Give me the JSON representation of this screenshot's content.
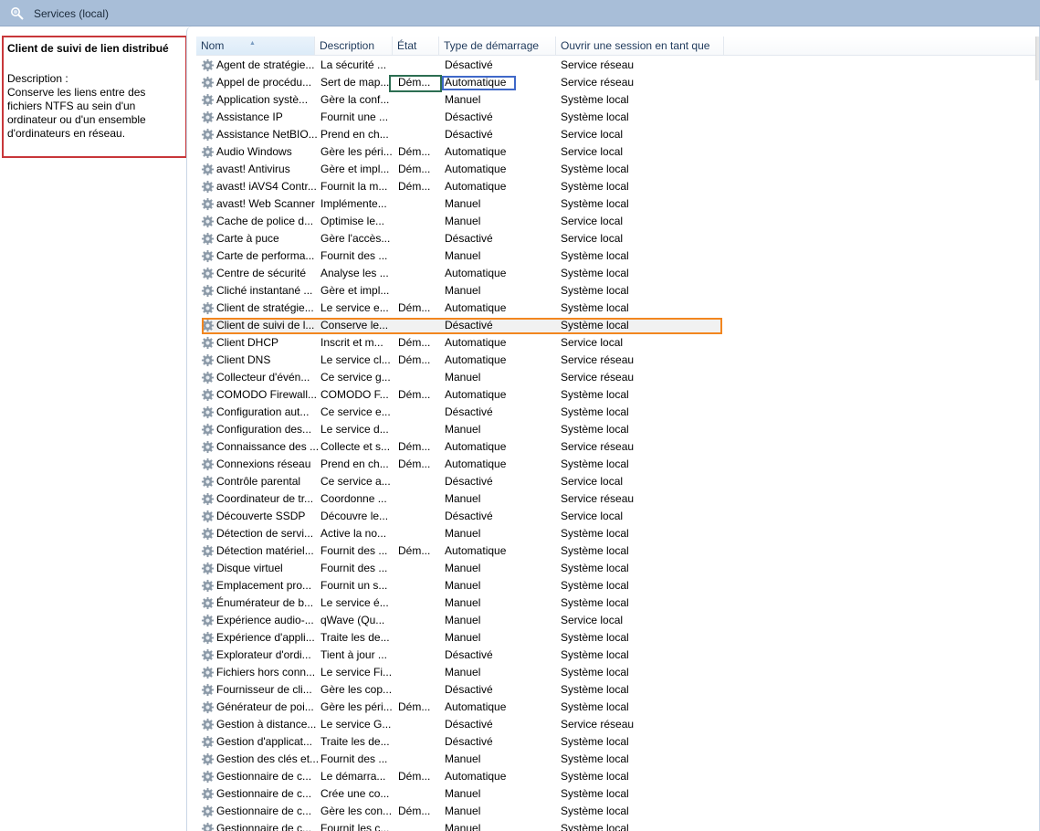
{
  "window": {
    "title": "Services (local)",
    "icon": "services-gear-search-icon"
  },
  "detail": {
    "service_name": "Client de suivi de lien distribué",
    "description_label": "Description :",
    "description_text": "Conserve les liens entre des fichiers NTFS au sein d'un ordinateur ou d'un ensemble d'ordinateurs en réseau."
  },
  "columns": [
    {
      "key": "name",
      "label": "Nom"
    },
    {
      "key": "description",
      "label": "Description"
    },
    {
      "key": "state",
      "label": "État"
    },
    {
      "key": "startup",
      "label": "Type de démarrage"
    },
    {
      "key": "logon",
      "label": "Ouvrir une session en tant que"
    }
  ],
  "sorted_column": "name",
  "selected_row_index": 15,
  "highlight_colors": {
    "details_box": "#c8373a",
    "selected_row": "#f2861f",
    "state_cell": "#2c6e52",
    "startup_cell": "#3f68c8"
  },
  "rows": [
    {
      "name": "Agent de stratégie...",
      "description": "La sécurité ...",
      "state": "",
      "startup": "Désactivé",
      "logon": "Service réseau"
    },
    {
      "name": "Appel de procédu...",
      "description": "Sert de map...",
      "state": "Dém...",
      "startup": "Automatique",
      "logon": "Service réseau"
    },
    {
      "name": "Application systè...",
      "description": "Gère la conf...",
      "state": "",
      "startup": "Manuel",
      "logon": "Système local"
    },
    {
      "name": "Assistance IP",
      "description": "Fournit une ...",
      "state": "",
      "startup": "Désactivé",
      "logon": "Système local"
    },
    {
      "name": "Assistance NetBIO...",
      "description": "Prend en ch...",
      "state": "",
      "startup": "Désactivé",
      "logon": "Service local"
    },
    {
      "name": "Audio Windows",
      "description": "Gère les péri...",
      "state": "Dém...",
      "startup": "Automatique",
      "logon": "Service local"
    },
    {
      "name": "avast! Antivirus",
      "description": "Gère et impl...",
      "state": "Dém...",
      "startup": "Automatique",
      "logon": "Système local"
    },
    {
      "name": "avast! iAVS4 Contr...",
      "description": "Fournit la m...",
      "state": "Dém...",
      "startup": "Automatique",
      "logon": "Système local"
    },
    {
      "name": "avast! Web Scanner",
      "description": "Implémente...",
      "state": "",
      "startup": "Manuel",
      "logon": "Système local"
    },
    {
      "name": "Cache de police d...",
      "description": "Optimise le...",
      "state": "",
      "startup": "Manuel",
      "logon": "Service local"
    },
    {
      "name": "Carte à puce",
      "description": "Gère l'accès...",
      "state": "",
      "startup": "Désactivé",
      "logon": "Service local"
    },
    {
      "name": "Carte de performa...",
      "description": "Fournit des ...",
      "state": "",
      "startup": "Manuel",
      "logon": "Système local"
    },
    {
      "name": "Centre de sécurité",
      "description": "Analyse les ...",
      "state": "",
      "startup": "Automatique",
      "logon": "Système local"
    },
    {
      "name": "Cliché instantané ...",
      "description": "Gère et impl...",
      "state": "",
      "startup": "Manuel",
      "logon": "Système local"
    },
    {
      "name": "Client de stratégie...",
      "description": "Le service e...",
      "state": "Dém...",
      "startup": "Automatique",
      "logon": "Système local"
    },
    {
      "name": "Client de suivi de l...",
      "description": "Conserve le...",
      "state": "",
      "startup": "Désactivé",
      "logon": "Système local"
    },
    {
      "name": "Client DHCP",
      "description": "Inscrit et m...",
      "state": "Dém...",
      "startup": "Automatique",
      "logon": "Service local"
    },
    {
      "name": "Client DNS",
      "description": "Le service cl...",
      "state": "Dém...",
      "startup": "Automatique",
      "logon": "Service réseau"
    },
    {
      "name": "Collecteur d'évén...",
      "description": "Ce service g...",
      "state": "",
      "startup": "Manuel",
      "logon": "Service réseau"
    },
    {
      "name": "COMODO Firewall...",
      "description": "COMODO F...",
      "state": "Dém...",
      "startup": "Automatique",
      "logon": "Système local"
    },
    {
      "name": "Configuration aut...",
      "description": "Ce service e...",
      "state": "",
      "startup": "Désactivé",
      "logon": "Système local"
    },
    {
      "name": "Configuration des...",
      "description": "Le service d...",
      "state": "",
      "startup": "Manuel",
      "logon": "Système local"
    },
    {
      "name": "Connaissance des ...",
      "description": "Collecte et s...",
      "state": "Dém...",
      "startup": "Automatique",
      "logon": "Service réseau"
    },
    {
      "name": "Connexions réseau",
      "description": "Prend en ch...",
      "state": "Dém...",
      "startup": "Automatique",
      "logon": "Système local"
    },
    {
      "name": "Contrôle parental",
      "description": "Ce service a...",
      "state": "",
      "startup": "Désactivé",
      "logon": "Service local"
    },
    {
      "name": "Coordinateur de tr...",
      "description": "Coordonne ...",
      "state": "",
      "startup": "Manuel",
      "logon": "Service réseau"
    },
    {
      "name": "Découverte SSDP",
      "description": "Découvre le...",
      "state": "",
      "startup": "Désactivé",
      "logon": "Service local"
    },
    {
      "name": "Détection de servi...",
      "description": "Active la no...",
      "state": "",
      "startup": "Manuel",
      "logon": "Système local"
    },
    {
      "name": "Détection matériel...",
      "description": "Fournit des ...",
      "state": "Dém...",
      "startup": "Automatique",
      "logon": "Système local"
    },
    {
      "name": "Disque virtuel",
      "description": "Fournit des ...",
      "state": "",
      "startup": "Manuel",
      "logon": "Système local"
    },
    {
      "name": "Emplacement pro...",
      "description": "Fournit un s...",
      "state": "",
      "startup": "Manuel",
      "logon": "Système local"
    },
    {
      "name": "Énumérateur de b...",
      "description": "Le service é...",
      "state": "",
      "startup": "Manuel",
      "logon": "Système local"
    },
    {
      "name": "Expérience audio-...",
      "description": "qWave (Qu...",
      "state": "",
      "startup": "Manuel",
      "logon": "Service local"
    },
    {
      "name": "Expérience d'appli...",
      "description": "Traite les de...",
      "state": "",
      "startup": "Manuel",
      "logon": "Système local"
    },
    {
      "name": "Explorateur d'ordi...",
      "description": "Tient à jour ...",
      "state": "",
      "startup": "Désactivé",
      "logon": "Système local"
    },
    {
      "name": "Fichiers hors conn...",
      "description": "Le service Fi...",
      "state": "",
      "startup": "Manuel",
      "logon": "Système local"
    },
    {
      "name": "Fournisseur de cli...",
      "description": "Gère les cop...",
      "state": "",
      "startup": "Désactivé",
      "logon": "Système local"
    },
    {
      "name": "Générateur de poi...",
      "description": "Gère les péri...",
      "state": "Dém...",
      "startup": "Automatique",
      "logon": "Système local"
    },
    {
      "name": "Gestion à distance...",
      "description": "Le service G...",
      "state": "",
      "startup": "Désactivé",
      "logon": "Service réseau"
    },
    {
      "name": "Gestion d'applicat...",
      "description": "Traite les de...",
      "state": "",
      "startup": "Désactivé",
      "logon": "Système local"
    },
    {
      "name": "Gestion des clés et...",
      "description": "Fournit des ...",
      "state": "",
      "startup": "Manuel",
      "logon": "Système local"
    },
    {
      "name": "Gestionnaire de c...",
      "description": "Le démarra...",
      "state": "Dém...",
      "startup": "Automatique",
      "logon": "Système local"
    },
    {
      "name": "Gestionnaire de c...",
      "description": "Crée une co...",
      "state": "",
      "startup": "Manuel",
      "logon": "Système local"
    },
    {
      "name": "Gestionnaire de c...",
      "description": "Gère les con...",
      "state": "Dém...",
      "startup": "Manuel",
      "logon": "Système local"
    },
    {
      "name": "Gestionnaire de c...",
      "description": "Fournit les c...",
      "state": "",
      "startup": "Manuel",
      "logon": "Système local"
    }
  ]
}
